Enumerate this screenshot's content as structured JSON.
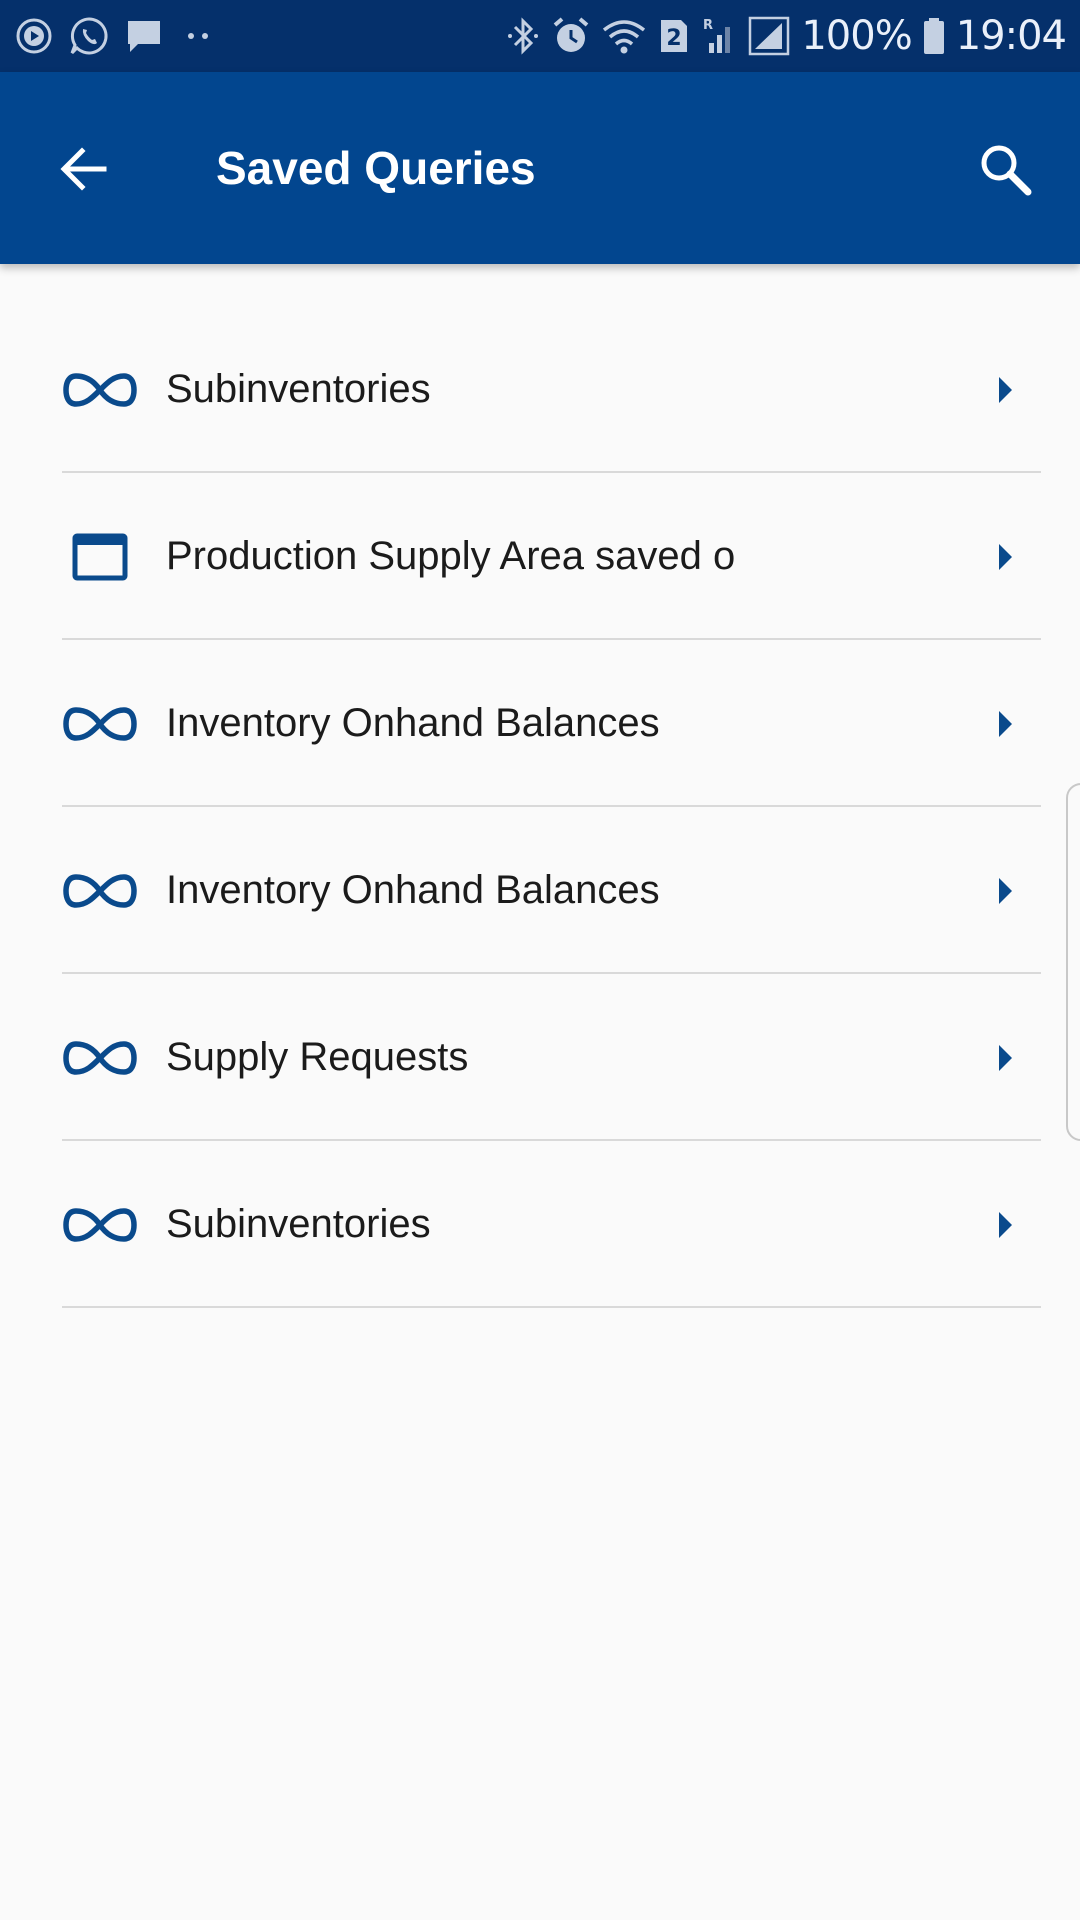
{
  "status_bar": {
    "left_icons": [
      "media-play-icon",
      "whatsapp-icon",
      "message-icon",
      "more-dots-icon"
    ],
    "right_icons": [
      "bluetooth-icon",
      "alarm-icon",
      "wifi-icon",
      "sim-2-icon",
      "roaming-signal-icon",
      "signal-icon",
      "battery-icon"
    ],
    "sim_label": "2",
    "roaming_label": "R",
    "battery": "100%",
    "time": "19:04"
  },
  "app_bar": {
    "title": "Saved Queries",
    "back_icon": "back-arrow-icon",
    "search_icon": "search-icon"
  },
  "queries": [
    {
      "label": "Subinventories",
      "icon": "infinity-icon"
    },
    {
      "label": "Production Supply Area saved o",
      "icon": "window-icon"
    },
    {
      "label": "Inventory Onhand Balances",
      "icon": "infinity-icon"
    },
    {
      "label": "Inventory Onhand Balances",
      "icon": "infinity-icon"
    },
    {
      "label": "Supply Requests",
      "icon": "infinity-icon"
    },
    {
      "label": "Subinventories",
      "icon": "infinity-icon"
    }
  ],
  "colors": {
    "status_bar": "#05306b",
    "app_bar": "#02468f",
    "accent": "#0a4a8c",
    "background": "#fafafa",
    "divider": "#d9d9d9"
  }
}
